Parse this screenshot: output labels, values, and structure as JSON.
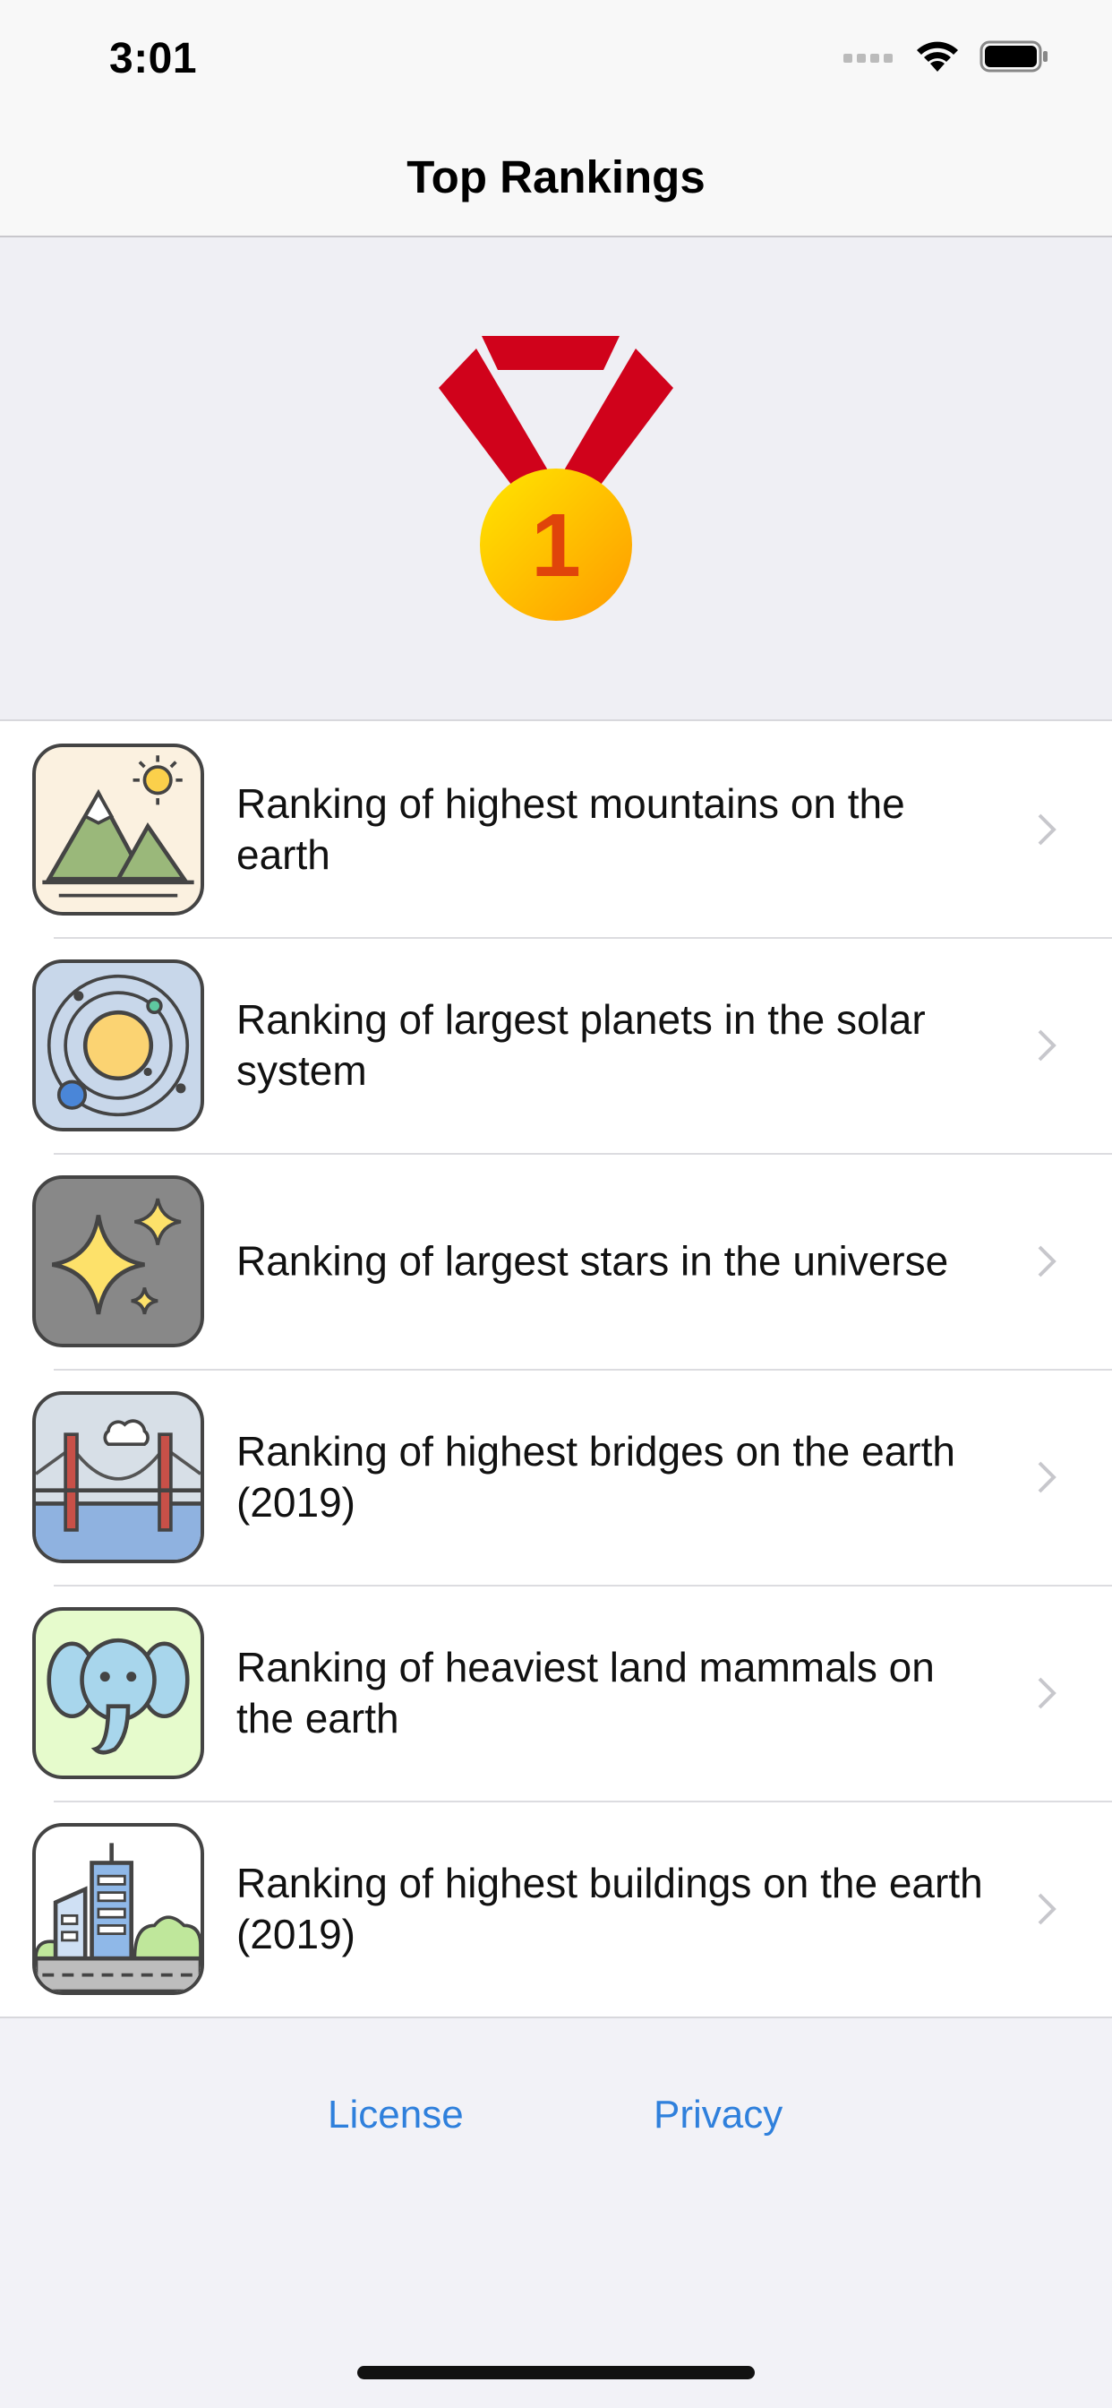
{
  "status_bar": {
    "time": "3:01",
    "icons": [
      "signal-icon",
      "wifi-icon",
      "battery-icon"
    ]
  },
  "nav": {
    "title": "Top Rankings"
  },
  "hero": {
    "icon": "medal-icon",
    "medal_number": "1"
  },
  "rankings": [
    {
      "label": "Ranking of highest mountains on the earth",
      "icon": "mountain-icon"
    },
    {
      "label": "Ranking of largest planets in the solar system",
      "icon": "solar-system-icon"
    },
    {
      "label": "Ranking of largest stars in the universe",
      "icon": "stars-icon"
    },
    {
      "label": "Ranking of highest bridges on the earth (2019)",
      "icon": "bridge-icon"
    },
    {
      "label": "Ranking of heaviest land mammals on the earth",
      "icon": "elephant-icon"
    },
    {
      "label": "Ranking of highest buildings on the earth (2019)",
      "icon": "building-icon"
    }
  ],
  "footer": {
    "license": "License",
    "privacy": "Privacy"
  },
  "colors": {
    "link": "#2f80dc",
    "medal_ribbon": "#d0021b",
    "medal_gold": "#ffc400"
  }
}
